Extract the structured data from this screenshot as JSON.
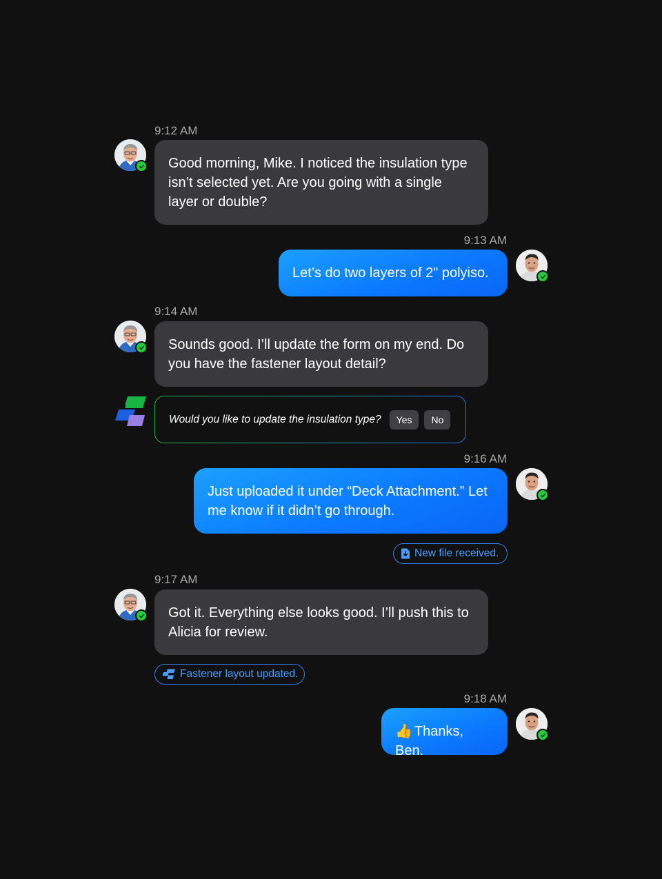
{
  "messages": [
    {
      "time": "9:12 AM",
      "sender": "Ben",
      "direction": "incoming",
      "text": "Good morning, Mike. I noticed the insulation type isn’t selected yet. Are you going with a single layer or double?"
    },
    {
      "time": "9:13 AM",
      "sender": "Mike",
      "direction": "outgoing",
      "text": "Let’s do two layers of 2\" polyiso."
    },
    {
      "time": "9:14 AM",
      "sender": "Ben",
      "direction": "incoming",
      "text": "Sounds good. I’ll update the form on my end. Do you have the fastener layout detail?"
    },
    {
      "time": "9:16 AM",
      "sender": "Mike",
      "direction": "outgoing",
      "text": "Just uploaded it under “Deck Attachment.” Let me know if it didn’t go through."
    },
    {
      "time": "9:17 AM",
      "sender": "Ben",
      "direction": "incoming",
      "text": "Got it. Everything else looks good. I’ll push this to Alicia for review."
    },
    {
      "time": "9:18 AM",
      "sender": "Mike",
      "direction": "outgoing",
      "emoji": "👍",
      "text": "Thanks, Ben."
    }
  ],
  "assistant_prompt": {
    "question": "Would you like to update the insulation type?",
    "yes_label": "Yes",
    "no_label": "No"
  },
  "notices": {
    "file_received": "New file received.",
    "layout_updated": "Fastener layout updated."
  },
  "colors": {
    "background": "#111111",
    "incoming_bubble": "#3a3a3e",
    "outgoing_bubble": "#0b7bff",
    "online_badge": "#27c93f",
    "chip_accent": "#4a9cff"
  },
  "icons": {
    "presence": "check-icon",
    "file": "file-download-icon",
    "brand": "app-logo-icon"
  }
}
